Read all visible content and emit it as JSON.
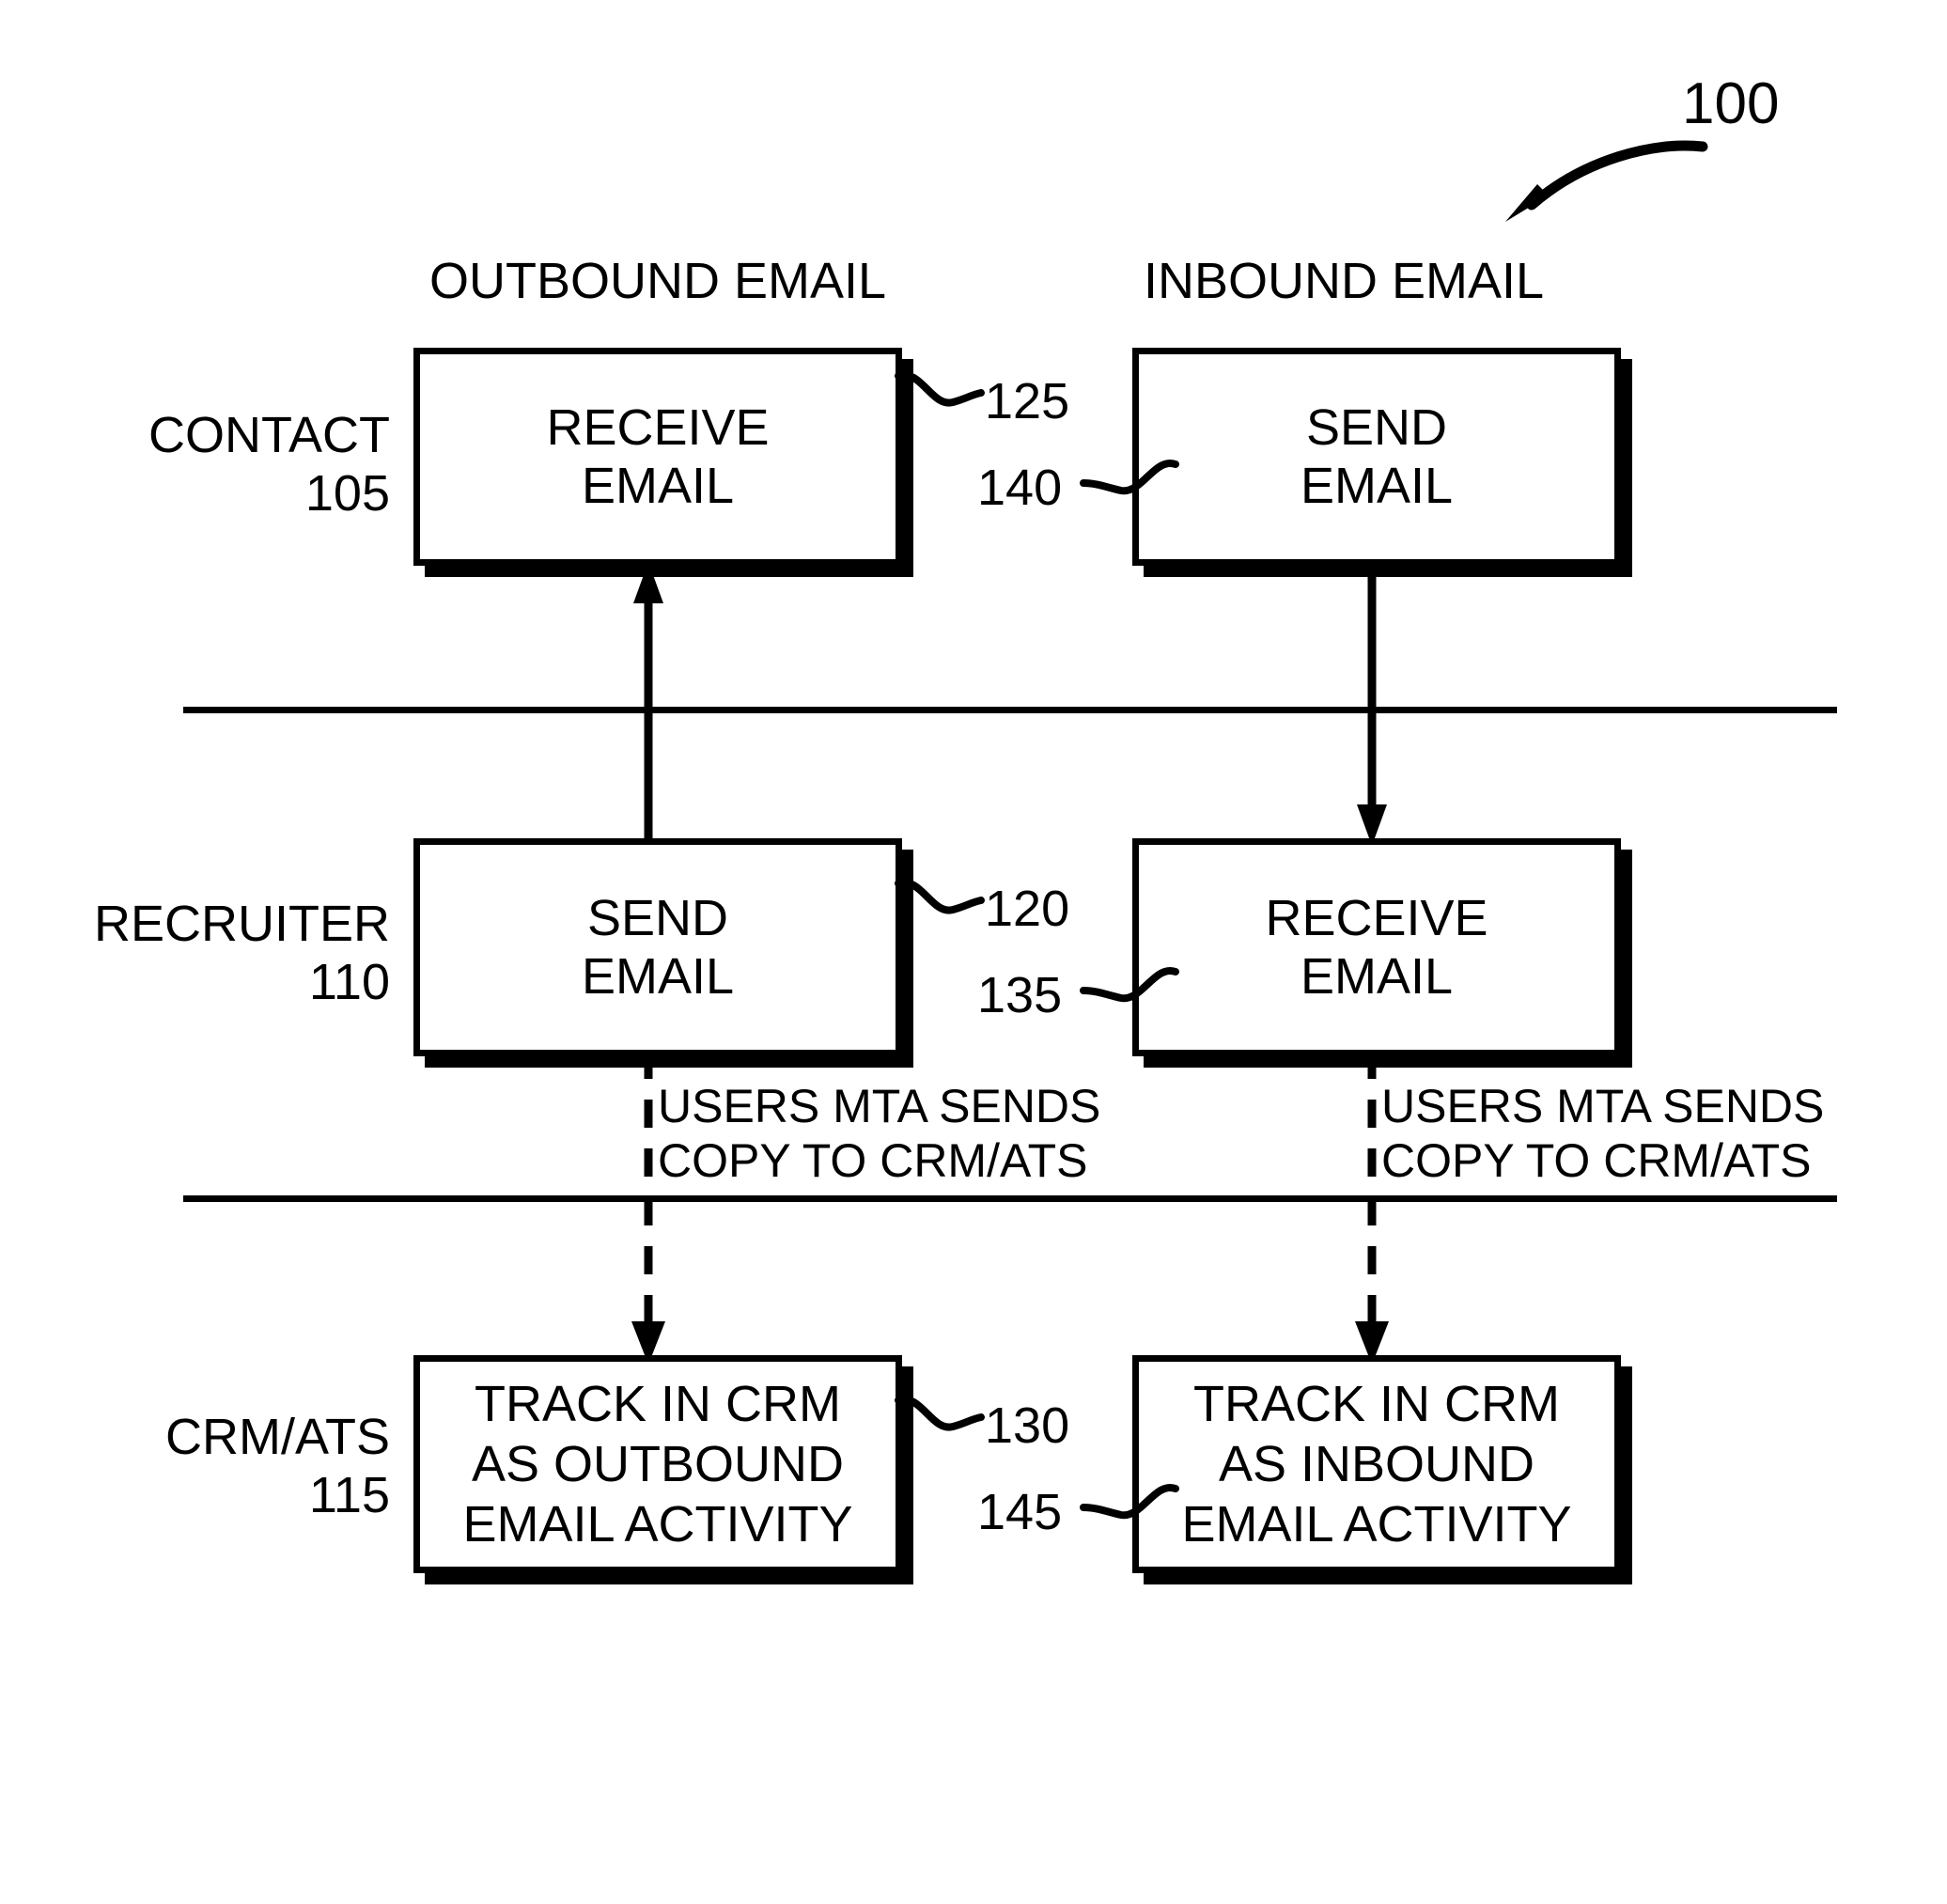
{
  "figure": {
    "number": "100",
    "arrow_icon": "curved-arrow-icon"
  },
  "columns": [
    {
      "id": "outbound",
      "label": "OUTBOUND EMAIL"
    },
    {
      "id": "inbound",
      "label": "INBOUND EMAIL"
    }
  ],
  "rows": [
    {
      "id": "contact",
      "name": "CONTACT",
      "number": "105"
    },
    {
      "id": "recruiter",
      "name": "RECRUITER",
      "number": "110"
    },
    {
      "id": "crmats",
      "name": "CRM/ATS",
      "number": "115"
    }
  ],
  "boxes": {
    "contact_receive": {
      "text": "RECEIVE\nEMAIL",
      "ref": "125"
    },
    "contact_send": {
      "text": "SEND\nEMAIL",
      "ref": "140"
    },
    "recruiter_send": {
      "text": "SEND\nEMAIL",
      "ref": "120"
    },
    "recruiter_receive": {
      "text": "RECEIVE\nEMAIL",
      "ref": "135"
    },
    "crm_outbound": {
      "text": "TRACK IN CRM\nAS OUTBOUND\nEMAIL ACTIVITY",
      "ref": "130"
    },
    "crm_inbound": {
      "text": "TRACK IN CRM\nAS INBOUND\nEMAIL ACTIVITY",
      "ref": "145"
    }
  },
  "annotations": {
    "mta_outbound": "USERS MTA SENDS\nCOPY TO CRM/ATS",
    "mta_inbound": "USERS MTA SENDS\nCOPY TO CRM/ATS"
  },
  "connectors": [
    {
      "id": "outbound-recruiter-to-contact",
      "style": "solid",
      "direction": "up",
      "icon": "arrow-up-icon"
    },
    {
      "id": "inbound-contact-to-recruiter",
      "style": "solid",
      "direction": "down",
      "icon": "arrow-down-icon"
    },
    {
      "id": "outbound-recruiter-to-crm",
      "style": "dashed",
      "direction": "down",
      "icon": "dashed-arrow-down-icon"
    },
    {
      "id": "inbound-recruiter-to-crm",
      "style": "dashed",
      "direction": "down",
      "icon": "dashed-arrow-down-icon"
    }
  ],
  "colors": {
    "ink": "#000000",
    "paper": "#ffffff"
  }
}
